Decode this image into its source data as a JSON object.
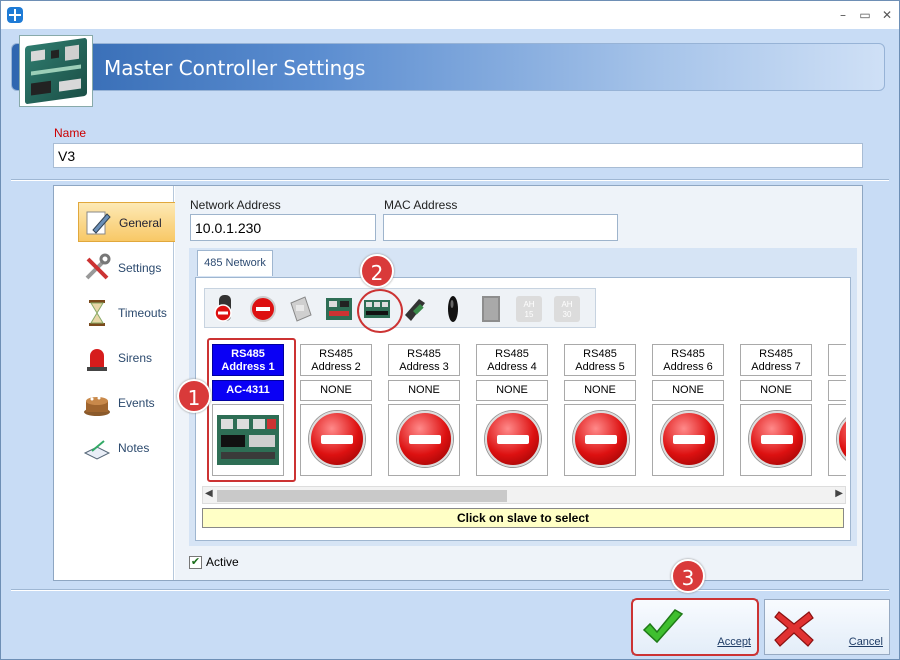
{
  "window": {
    "title": "",
    "minimize": "–",
    "maximize": "▭",
    "close": "✕"
  },
  "header": {
    "title": "Master Controller Settings"
  },
  "name_field": {
    "label": "Name",
    "value": "V3"
  },
  "sidebar": {
    "items": [
      {
        "label": "General",
        "icon": "pen-icon"
      },
      {
        "label": "Settings",
        "icon": "tools-icon"
      },
      {
        "label": "Timeouts",
        "icon": "hourglass-icon"
      },
      {
        "label": "Sirens",
        "icon": "siren-icon"
      },
      {
        "label": "Events",
        "icon": "cake-icon"
      },
      {
        "label": "Notes",
        "icon": "notes-icon"
      }
    ]
  },
  "general": {
    "network_address_label": "Network Address",
    "network_address": "10.0.1.230",
    "mac_address_label": "MAC Address",
    "mac_address": ""
  },
  "network_tab": {
    "label": "485 Network"
  },
  "slaves": [
    {
      "header": "RS485\nAddress 1",
      "type": "AC-4311",
      "selected": true
    },
    {
      "header": "RS485\nAddress 2",
      "type": "NONE"
    },
    {
      "header": "RS485\nAddress 3",
      "type": "NONE"
    },
    {
      "header": "RS485\nAddress 4",
      "type": "NONE"
    },
    {
      "header": "RS485\nAddress 5",
      "type": "NONE"
    },
    {
      "header": "RS485\nAddress 6",
      "type": "NONE"
    },
    {
      "header": "RS485\nAddress 7",
      "type": "NONE"
    }
  ],
  "toolbar_icons": [
    {
      "label": "",
      "icon": "reader-remove-icon"
    },
    {
      "label": "",
      "icon": "none-icon"
    },
    {
      "label": "",
      "icon": "module-grey-icon"
    },
    {
      "label": "",
      "icon": "board-icon"
    },
    {
      "label": "",
      "icon": "board-selected-icon"
    },
    {
      "label": "",
      "icon": "reader-dark-icon"
    },
    {
      "label": "",
      "icon": "fob-icon"
    },
    {
      "label": "",
      "icon": "panel-grey-icon"
    },
    {
      "label": "AH\n15",
      "icon": "ah15-icon"
    },
    {
      "label": "AH\n30",
      "icon": "ah30-icon"
    }
  ],
  "hint": "Click on slave to select",
  "active": {
    "label": "Active",
    "checked": true
  },
  "buttons": {
    "accept": "Accept",
    "cancel": "Cancel"
  },
  "badges": [
    "1",
    "2",
    "3"
  ],
  "colors": {
    "selected_slave": "#0a00f5",
    "accent": "#d93a3a",
    "nav_active": "#f8c866"
  }
}
